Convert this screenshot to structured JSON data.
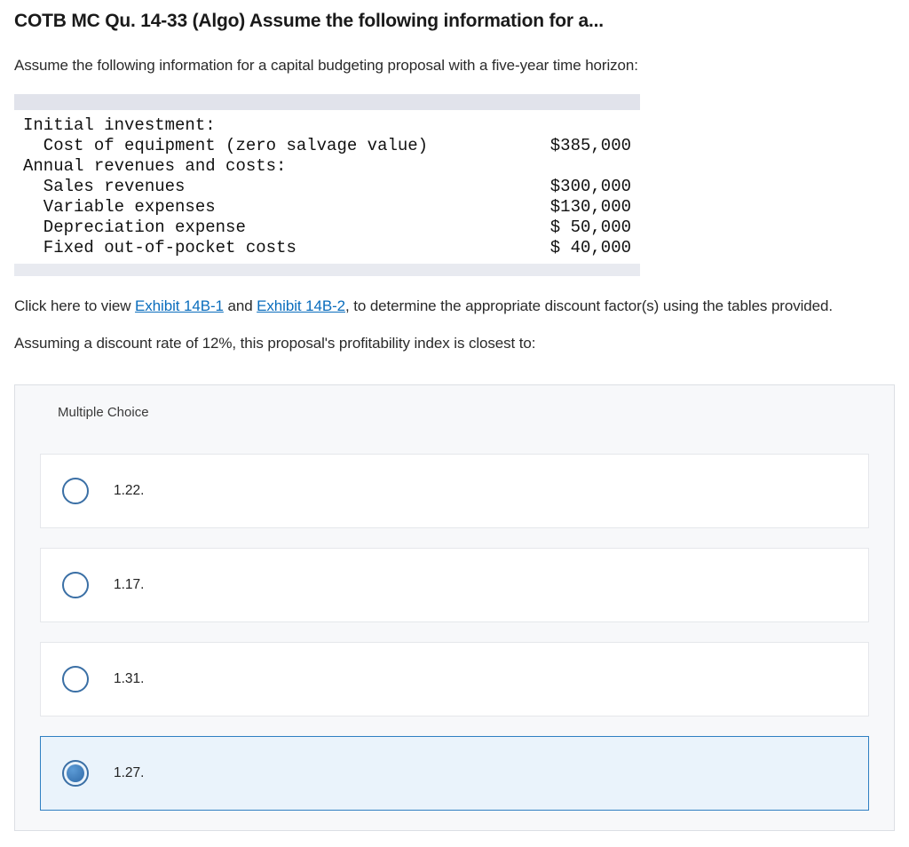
{
  "title": "COTB MC Qu. 14-33 (Algo) Assume the following information for a...",
  "intro": "Assume the following information for a capital budgeting proposal with a five-year time horizon:",
  "table": {
    "r0": {
      "label": "Initial investment:",
      "value": ""
    },
    "r1": {
      "label": "  Cost of equipment (zero salvage value)",
      "value": "$385,000"
    },
    "r2": {
      "label": "Annual revenues and costs:",
      "value": ""
    },
    "r3": {
      "label": "  Sales revenues",
      "value": "$300,000"
    },
    "r4": {
      "label": "  Variable expenses",
      "value": "$130,000"
    },
    "r5": {
      "label": "  Depreciation expense",
      "value": "$ 50,000"
    },
    "r6": {
      "label": "  Fixed out-of-pocket costs",
      "value": "$ 40,000"
    }
  },
  "links_line": {
    "prefix": "Click here to view ",
    "link1": "Exhibit 14B-1",
    "mid": " and ",
    "link2": "Exhibit 14B-2",
    "suffix": ", to determine the appropriate discount factor(s) using the tables provided."
  },
  "assumption": "Assuming a discount rate of 12%, this proposal's profitability index is closest to:",
  "mc_header": "Multiple Choice",
  "options": {
    "a": "1.22.",
    "b": "1.17.",
    "c": "1.31.",
    "d": "1.27."
  }
}
